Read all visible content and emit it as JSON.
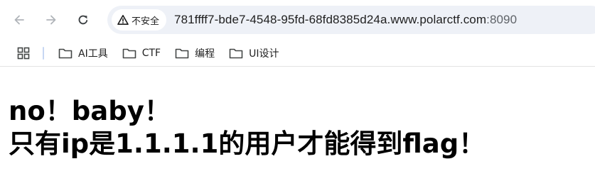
{
  "browser": {
    "security_label": "不安全",
    "url_host": "781ffff7-bde7-4548-95fd-68fd8385d24a.www.polarctf.com",
    "url_port": ":8090",
    "nav_icons": [
      "arrow-left-icon",
      "arrow-right-icon",
      "reload-icon"
    ],
    "security_icon": "warning-triangle-icon"
  },
  "bookmarks": {
    "apps_icon": "apps-grid-icon",
    "items": [
      {
        "label": "AI工具",
        "icon": "folder-icon"
      },
      {
        "label": "CTF",
        "icon": "folder-icon"
      },
      {
        "label": "编程",
        "icon": "folder-icon"
      },
      {
        "label": "UI设计",
        "icon": "folder-icon"
      }
    ]
  },
  "page": {
    "line1": "no！baby！",
    "line2": "只有ip是1.1.1.1的用户才能得到flag！"
  }
}
